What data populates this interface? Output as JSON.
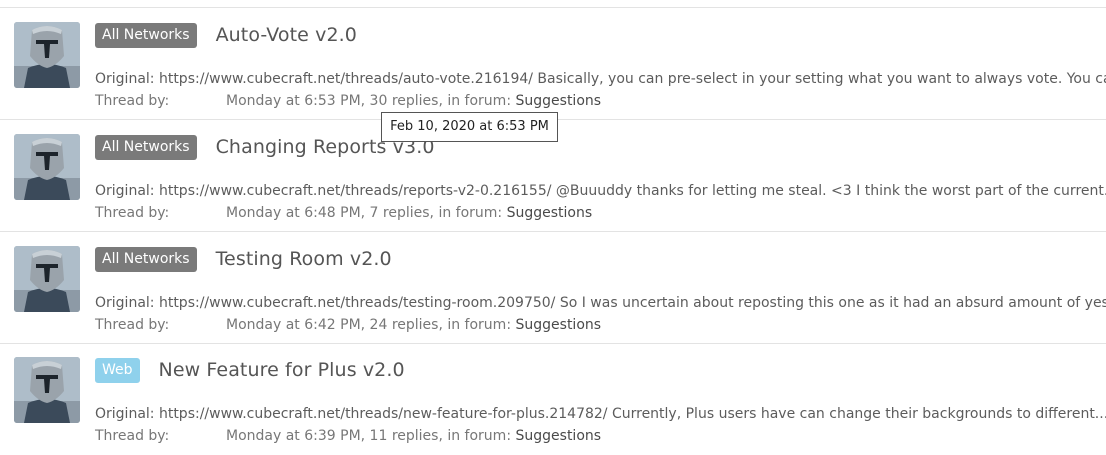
{
  "threads": [
    {
      "prefix": "All Networks",
      "prefix_style": "dark",
      "title": "Auto-Vote v2.0",
      "snippet": "Original: https://www.cubecraft.net/threads/auto-vote.216194/ Basically, you can pre-select in your setting what you want to always vote. You can",
      "thread_by_label": "Thread by:",
      "meta": "Monday at 6:53 PM, 30 replies, in forum: ",
      "forum": "Suggestions"
    },
    {
      "prefix": "All Networks",
      "prefix_style": "dark",
      "title": "Changing Reports v3.0",
      "snippet": "Original: https://www.cubecraft.net/threads/reports-v2-0.216155/ @Buuuddy thanks for letting me steal. <3 I think the worst part of the current...",
      "thread_by_label": "Thread by:",
      "meta": "Monday at 6:48 PM, 7 replies, in forum: ",
      "forum": "Suggestions"
    },
    {
      "prefix": "All Networks",
      "prefix_style": "dark",
      "title": "Testing Room v2.0",
      "snippet": "Original: https://www.cubecraft.net/threads/testing-room.209750/ So I was uncertain about reposting this one as it had an absurd amount of yes",
      "thread_by_label": "Thread by:",
      "meta": "Monday at 6:42 PM, 24 replies, in forum: ",
      "forum": "Suggestions"
    },
    {
      "prefix": "Web",
      "prefix_style": "light",
      "title": "New Feature for Plus v2.0",
      "snippet": "Original: https://www.cubecraft.net/threads/new-feature-for-plus.214782/ Currently, Plus users have can change their backgrounds to different...",
      "thread_by_label": "Thread by:",
      "meta": "Monday at 6:39 PM, 11 replies, in forum: ",
      "forum": "Suggestions"
    }
  ],
  "tooltip": {
    "text": "Feb 10, 2020 at 6:53 PM"
  },
  "colors": {
    "prefix_dark": "#7a7a7a",
    "prefix_light": "#8fd1ec",
    "divider": "#e3e3e3"
  },
  "icons": {
    "avatar": "mandalorian-avatar"
  }
}
